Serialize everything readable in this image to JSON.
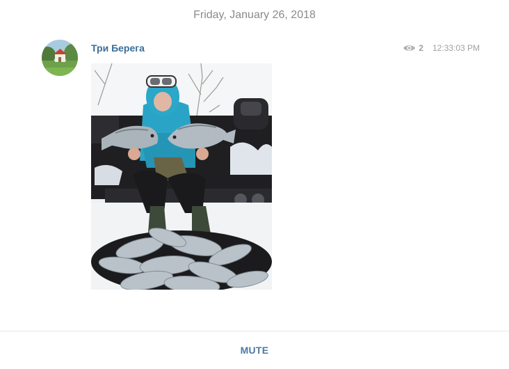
{
  "date_separator": "Friday, January 26, 2018",
  "message": {
    "channel_name": "Три Берега",
    "views": "2",
    "time": "12:33:03 PM",
    "photo_icon": "photo-ice-fishing",
    "avatar_icon": "channel-avatar"
  },
  "footer": {
    "mute_label": "MUTE"
  },
  "colors": {
    "link": "#3a6d99",
    "mute": "#4a7aa6",
    "muted_text": "#8a8a8a"
  }
}
